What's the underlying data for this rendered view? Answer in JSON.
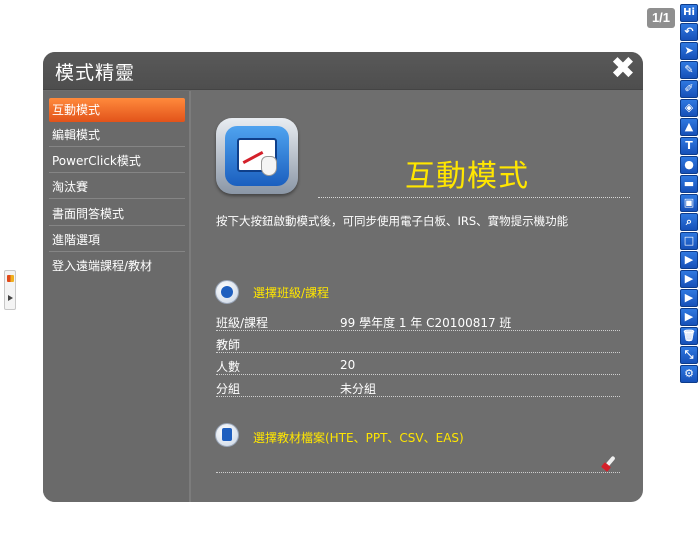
{
  "page_counter": "1/1",
  "toolbar": {
    "items": [
      {
        "label": "Hi",
        "icon": "hi-icon"
      },
      {
        "label": "↶",
        "icon": "undo-icon"
      },
      {
        "label": "➤",
        "icon": "pointer-icon"
      },
      {
        "label": "✎",
        "icon": "pen-icon"
      },
      {
        "label": "✐",
        "icon": "marker-icon"
      },
      {
        "label": "◈",
        "icon": "eraser-icon"
      },
      {
        "label": "▲",
        "icon": "shape-icon"
      },
      {
        "label": "T",
        "icon": "text-icon"
      },
      {
        "label": "●",
        "icon": "color-icon"
      },
      {
        "label": "▬",
        "icon": "highlighter-icon"
      },
      {
        "label": "▣",
        "icon": "camera-icon"
      },
      {
        "label": "⌕",
        "icon": "zoom-icon"
      },
      {
        "label": "□",
        "icon": "screen-icon"
      },
      {
        "label": "▶",
        "icon": "page-add-icon"
      },
      {
        "label": "▶",
        "icon": "page-next-icon"
      },
      {
        "label": "▶",
        "icon": "page-insert-icon"
      },
      {
        "label": "▶",
        "icon": "page-copy-icon"
      },
      {
        "label": "🗑",
        "icon": "trash-icon"
      },
      {
        "label": "⤡",
        "icon": "resize-icon"
      },
      {
        "label": "⚙",
        "icon": "settings-icon"
      }
    ]
  },
  "dialog": {
    "title": "模式精靈",
    "close_label": "✖"
  },
  "sidebar": {
    "items": [
      {
        "label": "互動模式",
        "active": true
      },
      {
        "label": "編輯模式",
        "active": false
      },
      {
        "label": "PowerClick模式",
        "active": false
      },
      {
        "label": "淘汰賽",
        "active": false
      },
      {
        "label": "書面問答模式",
        "active": false
      },
      {
        "label": "進階選項",
        "active": false
      },
      {
        "label": "登入遠端課程/教材",
        "active": false
      }
    ]
  },
  "main": {
    "mode_title": "互動模式",
    "description": "按下大按鈕啟動模式後，可同步使用電子白板、IRS、實物提示機功能",
    "class_section": {
      "label": "選擇班級/課程",
      "rows": [
        {
          "key": "班級/課程",
          "value": "99 學年度 1 年 C20100817 班"
        },
        {
          "key": "教師",
          "value": ""
        },
        {
          "key": "人數",
          "value": "20"
        },
        {
          "key": "分組",
          "value": "未分組"
        }
      ]
    },
    "file_section": {
      "label": "選擇教材檔案(HTE、PPT、CSV、EAS)"
    }
  },
  "colors": {
    "accent": "#ffe600",
    "active_tab": "#f0762a",
    "panel": "#6e6e6e",
    "toolbar": "#1f62cc"
  }
}
